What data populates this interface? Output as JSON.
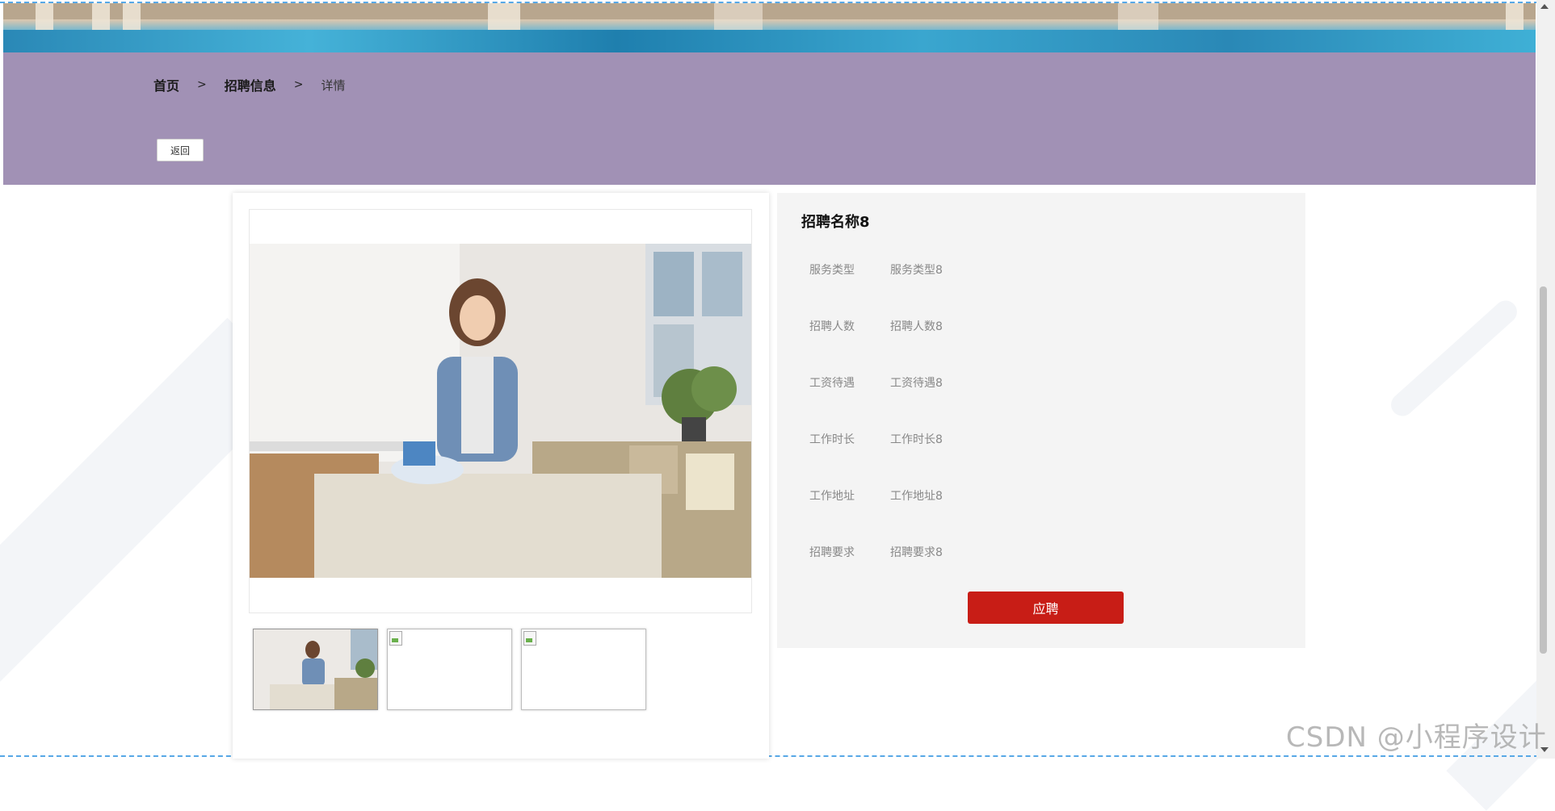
{
  "breadcrumb": {
    "home": "首页",
    "separator": ">",
    "section": "招聘信息",
    "current": "详情"
  },
  "back_button": "返回",
  "job": {
    "title": "招聘名称8",
    "fields": [
      {
        "label": "服务类型",
        "value": "服务类型8"
      },
      {
        "label": "招聘人数",
        "value": "招聘人数8"
      },
      {
        "label": "工资待遇",
        "value": "工资待遇8"
      },
      {
        "label": "工作时长",
        "value": "工作时长8"
      },
      {
        "label": "工作地址",
        "value": "工作地址8"
      },
      {
        "label": "招聘要求",
        "value": "招聘要求8"
      }
    ],
    "apply_label": "应聘"
  },
  "watermark": "CSDN @小程序设计",
  "colors": {
    "header_band": "#a191b5",
    "apply_button": "#c81d16",
    "info_panel": "#f4f4f4"
  }
}
